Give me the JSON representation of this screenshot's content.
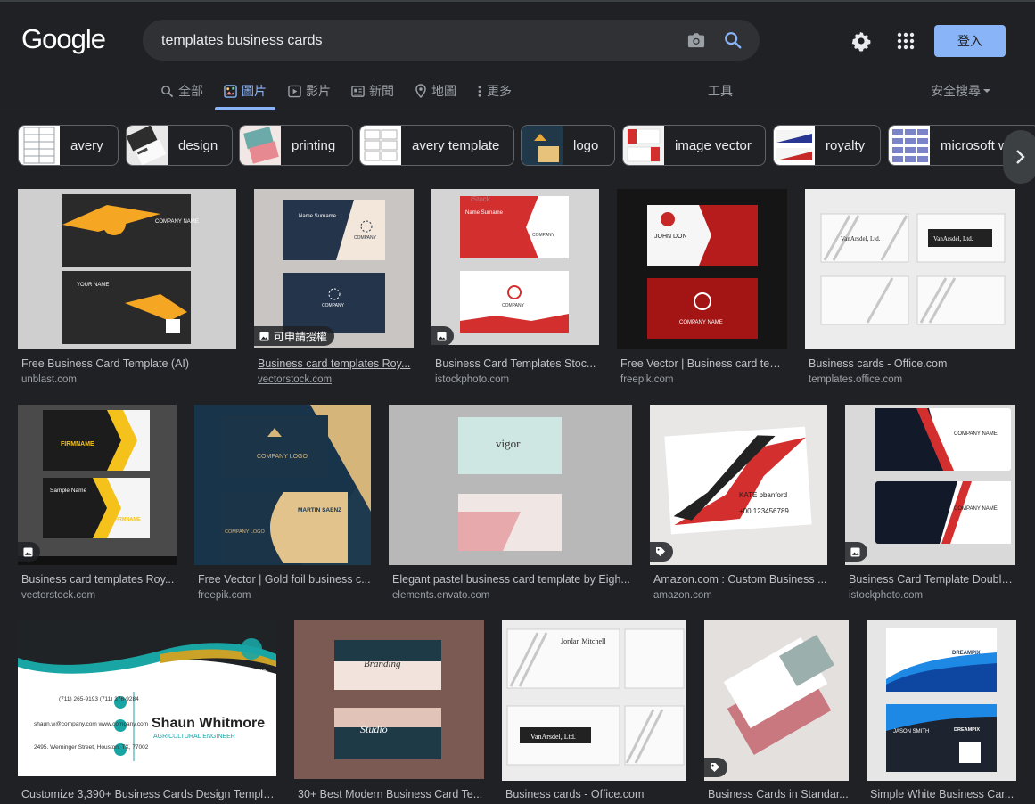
{
  "header": {
    "logo": "Google",
    "search_value": "templates business cards",
    "signin_label": "登入"
  },
  "tabs": [
    {
      "label": "全部",
      "icon": "search-icon"
    },
    {
      "label": "圖片",
      "icon": "image-icon"
    },
    {
      "label": "影片",
      "icon": "play-icon"
    },
    {
      "label": "新聞",
      "icon": "news-icon"
    },
    {
      "label": "地圖",
      "icon": "map-pin-icon"
    },
    {
      "label": "更多",
      "icon": "more-vert-icon"
    }
  ],
  "tools_label": "工具",
  "safe_search_label": "安全搜尋",
  "chips": [
    {
      "label": "avery"
    },
    {
      "label": "design"
    },
    {
      "label": "printing"
    },
    {
      "label": "avery template"
    },
    {
      "label": "logo"
    },
    {
      "label": "image vector"
    },
    {
      "label": "royalty"
    },
    {
      "label": "microsoft word"
    }
  ],
  "results": [
    {
      "title": "Free Business Card Template (AI)",
      "source": "unblast.com"
    },
    {
      "title": "Business card templates Roy...",
      "source": "vectorstock.com",
      "badge": "可申請授權"
    },
    {
      "title": "Business Card Templates Stoc...",
      "source": "istockphoto.com"
    },
    {
      "title": "Free Vector | Business card tem...",
      "source": "freepik.com"
    },
    {
      "title": "Business cards - Office.com",
      "source": "templates.office.com"
    },
    {
      "title": "Business card templates Roy...",
      "source": "vectorstock.com"
    },
    {
      "title": "Free Vector | Gold foil business c...",
      "source": "freepik.com"
    },
    {
      "title": "Elegant pastel business card template by Eigh...",
      "source": "elements.envato.com"
    },
    {
      "title": "Amazon.com : Custom Business ...",
      "source": "amazon.com"
    },
    {
      "title": "Business Card Template Double...",
      "source": "istockphoto.com"
    },
    {
      "title": "Customize 3,390+ Business Cards Design Templa...",
      "source": ""
    },
    {
      "title": "30+ Best Modern Business Card Te...",
      "source": ""
    },
    {
      "title": "Business cards - Office.com",
      "source": ""
    },
    {
      "title": "Business Cards in Standar...",
      "source": ""
    },
    {
      "title": "Simple White Business Car...",
      "source": ""
    }
  ],
  "thumb_text": {
    "company_name": "COMPANY NAME",
    "your_name": "YOUR NAME",
    "name_surname": "Name Surname",
    "company": "COMPANY",
    "john_don": "JOHN DON",
    "vanarsdel": "VanArsdel, Ltd.",
    "firmname": "FIRMNAME",
    "sample_name": "Sample Name",
    "company_logo": "COMPANY LOGO",
    "martin": "MARTIN SAENZ",
    "vigor": "vigor",
    "kate": "KATE  bbanford",
    "kate_phone": "+00 123456789",
    "shaun": "Shaun Whitmore",
    "shaun_role": "AGRICULTURAL ENGINEER",
    "shaun_phone": "(711) 265-9193\n(711) 376-9284",
    "shaun_mail": "shaun.w@company.com\nwww.company.com",
    "shaun_addr": "2495. Werninger Street,\nHouston, TX, 77002",
    "branding": "Branding",
    "studio": "Studio",
    "jordan": "Jordan Mitchell",
    "dreampix": "DREAMPIX",
    "jason": "JASON SMITH",
    "istock": "iStock"
  },
  "colors": {
    "background": "#202124",
    "accent": "#8ab4f8",
    "search_bg": "#303134"
  }
}
